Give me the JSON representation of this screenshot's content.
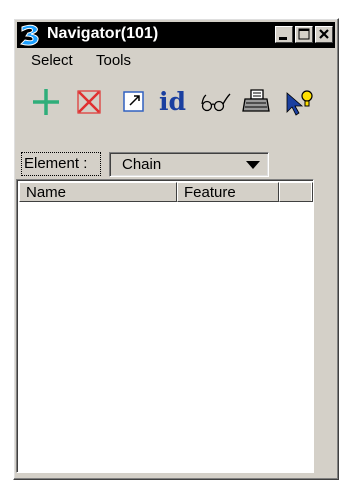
{
  "window": {
    "title": "Navigator(101)",
    "app_icon": "bentley-b-icon",
    "controls": [
      "minimize-icon",
      "maximize-icon",
      "close-icon"
    ]
  },
  "menu": {
    "items": [
      {
        "label": "Select"
      },
      {
        "label": "Tools"
      }
    ]
  },
  "toolbar": {
    "tools": [
      {
        "icon": "add-cross-icon",
        "color": "#2fae7a"
      },
      {
        "icon": "delete-x-icon",
        "color": "#e03030"
      },
      {
        "icon": "expand-arrow-icon",
        "color": "#3060c0"
      },
      {
        "icon": "id-icon",
        "text": "id",
        "color": "#1a3fa0"
      },
      {
        "icon": "glasses-icon"
      },
      {
        "icon": "print-icon"
      },
      {
        "icon": "pointer-lightbulb-icon"
      }
    ]
  },
  "element_filter": {
    "label": "Element :",
    "value": "Chain"
  },
  "list": {
    "columns": [
      {
        "label": "Name"
      },
      {
        "label": "Feature"
      },
      {
        "label": ""
      }
    ],
    "rows": []
  }
}
